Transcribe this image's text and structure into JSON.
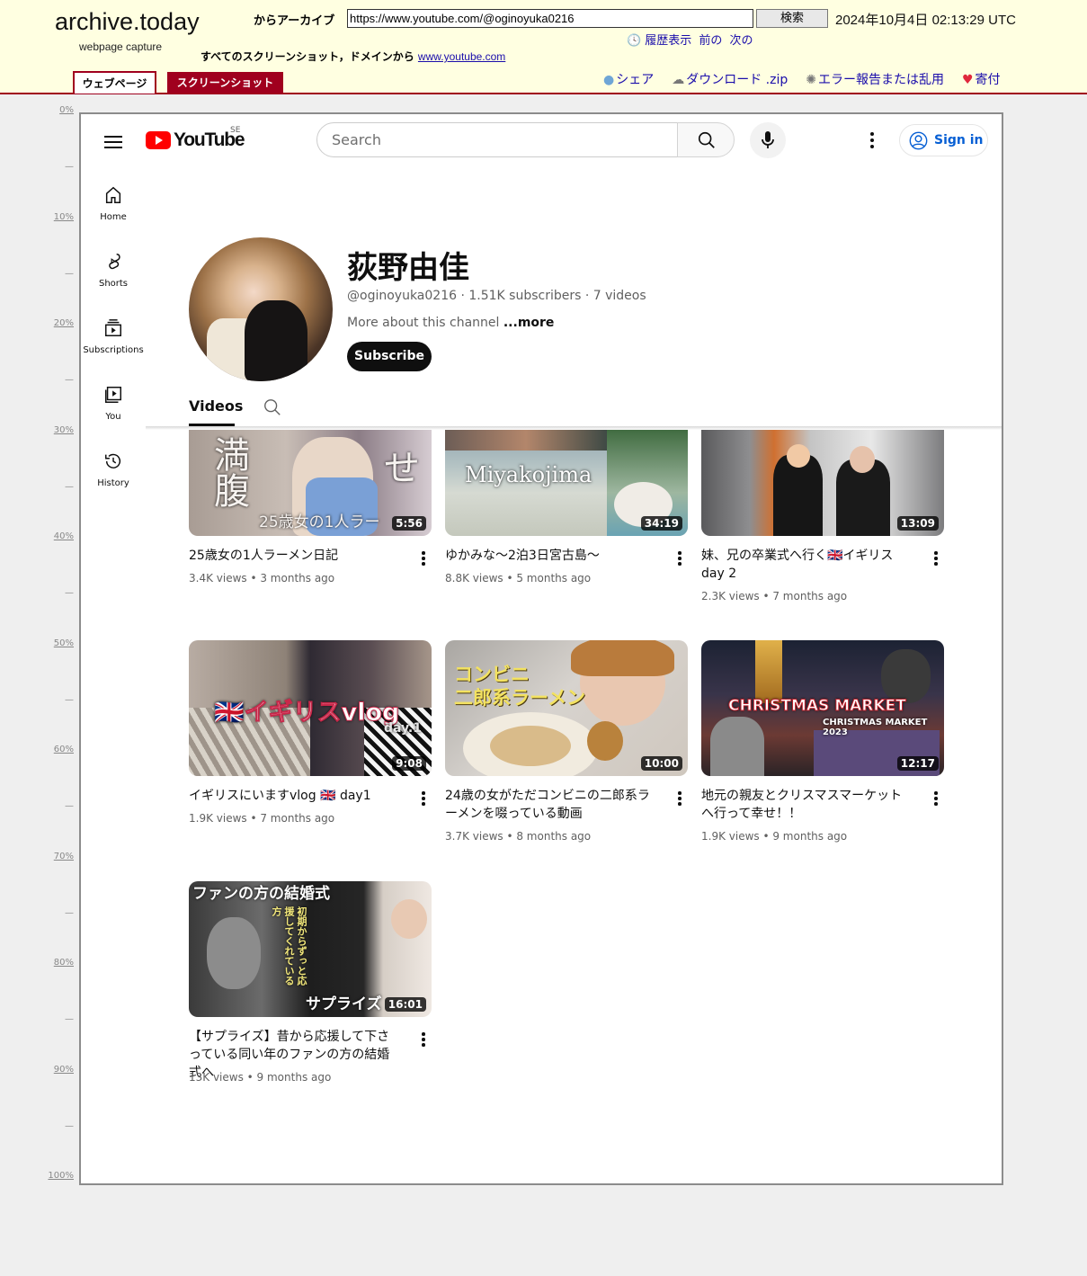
{
  "archive": {
    "logo": "archive.today",
    "sublogo": "webpage capture",
    "archive_label": "からアーカイブ",
    "url": "https://www.youtube.com/@oginoyuka0216",
    "search_button": "検索",
    "date": "2024年10月4日 02:13:29 UTC",
    "history": "履歴表示",
    "prev": "前の",
    "next": "次の",
    "all_screenshots": "すべてのスクリーンショット，ドメインから",
    "domain": "www.youtube.com",
    "tab_webpage": "ウェブページ",
    "tab_screenshot": "スクリーンショット",
    "share": "シェア",
    "download": "ダウンロード .zip",
    "report": "エラー報告または乱用",
    "donate": "寄付"
  },
  "ruler": [
    "0%",
    "—",
    "10%",
    "—",
    "20%",
    "—",
    "30%",
    "—",
    "40%",
    "—",
    "50%",
    "—",
    "60%",
    "—",
    "70%",
    "—",
    "80%",
    "—",
    "90%",
    "—",
    "100%"
  ],
  "yt": {
    "logo_text": "YouTube",
    "country": "SE",
    "search_placeholder": "Search",
    "sign_in": "Sign in",
    "nav": [
      "Home",
      "Shorts",
      "Subscriptions",
      "You",
      "History"
    ]
  },
  "channel": {
    "name": "荻野由佳",
    "meta": "@oginoyuka0216 · 1.51K subscribers · 7 videos",
    "more_text": "More about this channel",
    "more_link": "...more",
    "subscribe": "Subscribe",
    "tab_videos": "Videos"
  },
  "videos": [
    {
      "title": "25歳女の1人ラーメン日記",
      "meta": "3.4K views • 3 months ago",
      "duration": "5:56",
      "overlay": [
        "満",
        "腹",
        "せ",
        "25歳女の1人ラー"
      ]
    },
    {
      "title": "ゆかみな〜2泊3日宮古島〜",
      "meta": "8.8K views • 5 months ago",
      "duration": "34:19",
      "overlay": [
        "Miyakojima"
      ]
    },
    {
      "title": "妹、兄の卒業式へ行く🇬🇧イギリスday 2",
      "meta": "2.3K views • 7 months ago",
      "duration": "13:09",
      "overlay": []
    },
    {
      "title": "イギリスにいますvlog 🇬🇧 day1",
      "meta": "1.9K views • 7 months ago",
      "duration": "9:08",
      "overlay": [
        "🇬🇧イギリスvlog",
        "day.1"
      ]
    },
    {
      "title": "24歳の女がただコンビニの二郎系ラーメンを啜っている動画",
      "meta": "3.7K views • 8 months ago",
      "duration": "10:00",
      "overlay": [
        "コンビニ",
        "二郎系ラーメン"
      ]
    },
    {
      "title": "地元の親友とクリスマスマーケットへ行って幸せ！！",
      "meta": "1.9K views • 9 months ago",
      "duration": "12:17",
      "overlay": [
        "CHRISTMAS MARKET",
        "CHRISTMAS MARKET 2023"
      ]
    },
    {
      "title": "【サプライズ】昔から応援して下さっている同い年のファンの方の結婚式へ",
      "meta": "13K views • 9 months ago",
      "duration": "16:01",
      "overlay": [
        "ファンの方の結婚式",
        "初期からずっと応援してくれている方",
        "サプライズ"
      ]
    }
  ],
  "colors": {
    "archive_bg": "#ffffe1",
    "archive_red": "#a0001e",
    "yt_red": "#ff0000",
    "link_blue": "#065fd4"
  }
}
